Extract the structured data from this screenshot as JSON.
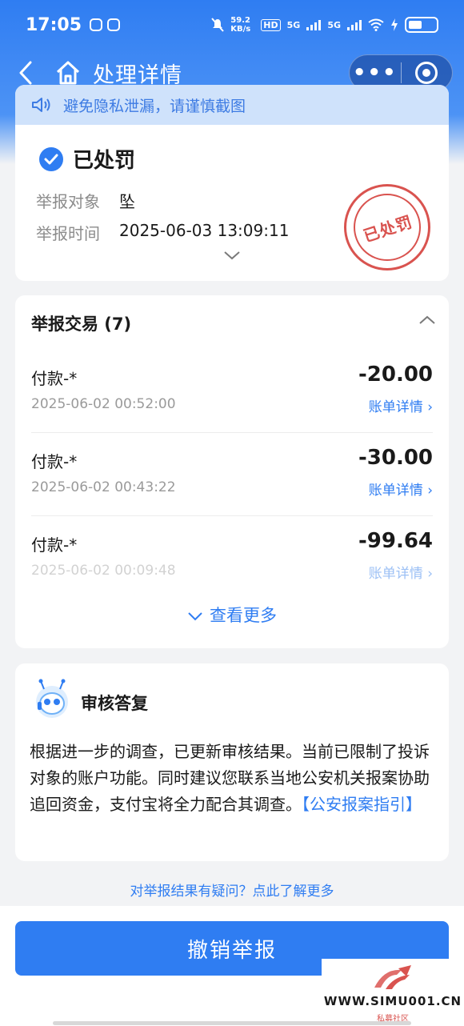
{
  "status_bar": {
    "time": "17:05",
    "net_speed": "59.2 KB/s",
    "hd": "HD",
    "signal_1": "5G",
    "signal_2": "5G"
  },
  "nav": {
    "title": "处理详情",
    "more_label": "•••"
  },
  "notice": {
    "text": "避免隐私泄漏，请谨慎截图"
  },
  "report": {
    "status": "已处罚",
    "target_label": "举报对象",
    "target_value": "坠",
    "time_label": "举报时间",
    "time_value": "2025-06-03 13:09:11",
    "stamp": "已处罚"
  },
  "transactions": {
    "header": "举报交易 (7)",
    "items": [
      {
        "name": "付款-*",
        "amount": "-20.00",
        "time": "2025-06-02 00:52:00",
        "link": "账单详情 ›"
      },
      {
        "name": "付款-*",
        "amount": "-30.00",
        "time": "2025-06-02 00:43:22",
        "link": "账单详情 ›"
      },
      {
        "name": "付款-*",
        "amount": "-99.64",
        "time": "2025-06-02 00:09:48",
        "link": "账单详情 ›"
      }
    ],
    "see_more": "查看更多"
  },
  "reply": {
    "title": "审核答复",
    "text": "根据进一步的调查，已更新审核结果。当前已限制了投诉对象的账户功能。同时建议您联系当地公安机关报案协助追回资金，支付宝将全力配合其调查。",
    "link": "【公安报案指引】"
  },
  "help_link": "对举报结果有疑问？点此了解更多",
  "revoke_button": "撤销举报",
  "watermark": {
    "text": "WWW.SIMU001.CN",
    "sub": "私募社区"
  },
  "colors": {
    "primary": "#2f7df2",
    "stamp": "#d9534f",
    "notice_bg": "#cfe2fb"
  }
}
